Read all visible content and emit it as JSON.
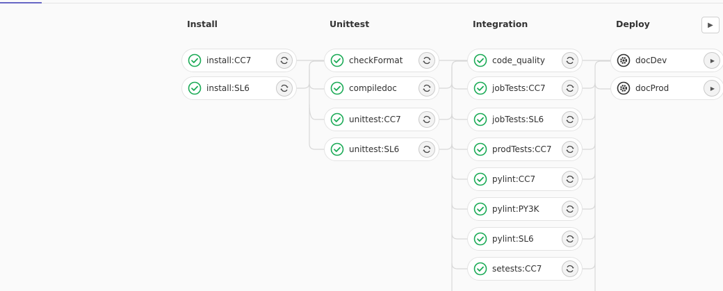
{
  "stages": [
    {
      "name": "Install",
      "jobs": [
        {
          "name": "install:CC7",
          "status": "success",
          "action": "retry"
        },
        {
          "name": "install:SL6",
          "status": "success",
          "action": "retry"
        }
      ]
    },
    {
      "name": "Unittest",
      "jobs": [
        {
          "name": "checkFormat",
          "status": "success",
          "action": "retry"
        },
        {
          "name": "compiledoc",
          "status": "success",
          "action": "retry"
        },
        {
          "name": "unittest:CC7",
          "status": "success",
          "action": "retry"
        },
        {
          "name": "unittest:SL6",
          "status": "success",
          "action": "retry"
        }
      ]
    },
    {
      "name": "Integration",
      "jobs": [
        {
          "name": "code_quality",
          "status": "success",
          "action": "retry"
        },
        {
          "name": "jobTests:CC7",
          "status": "success",
          "action": "retry"
        },
        {
          "name": "jobTests:SL6",
          "status": "success",
          "action": "retry"
        },
        {
          "name": "prodTests:CC7",
          "status": "success",
          "action": "retry"
        },
        {
          "name": "pylint:CC7",
          "status": "success",
          "action": "retry"
        },
        {
          "name": "pylint:PY3K",
          "status": "success",
          "action": "retry"
        },
        {
          "name": "pylint:SL6",
          "status": "success",
          "action": "retry"
        },
        {
          "name": "setests:CC7",
          "status": "success",
          "action": "retry"
        }
      ]
    },
    {
      "name": "Deploy",
      "jobs": [
        {
          "name": "docDev",
          "status": "manual",
          "action": "play"
        },
        {
          "name": "docProd",
          "status": "manual",
          "action": "play"
        }
      ]
    }
  ],
  "colors": {
    "success": "#1aaa55",
    "manual": "#303030",
    "border": "#e3e3e3",
    "accent": "#6666c4"
  },
  "icons": {
    "success": "check-circle-icon",
    "manual": "gear-icon",
    "retry": "retry-icon",
    "play": "play-icon"
  }
}
